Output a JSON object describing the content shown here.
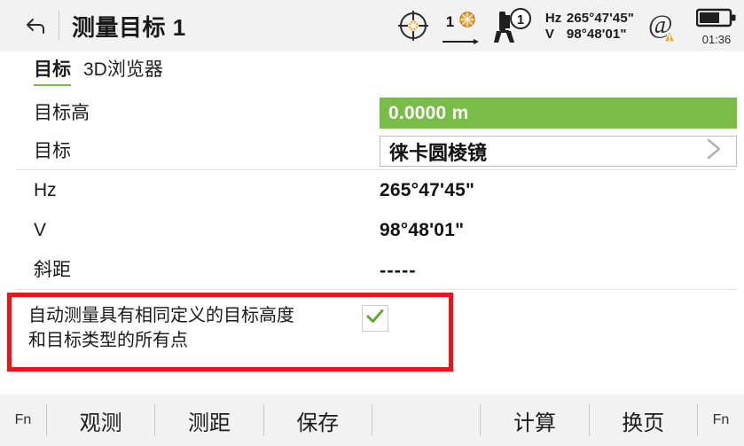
{
  "header": {
    "back_icon": "back-arrow-icon",
    "title": "测量目标 1"
  },
  "status_bar": {
    "target_lock_icon": "crosshair-target-icon",
    "prism_number": "1",
    "prism_icon": "prism-icon",
    "prism_arrow_icon": "arrow-right-icon",
    "instrument_icon": "total-station-icon",
    "instrument_badge": "1",
    "hz_label": "Hz",
    "hz_value": "265°47'45\"",
    "v_label": "V",
    "v_value": "98°48'01\"",
    "at_icon": "at-sign-warning-icon",
    "battery_icon": "battery-icon",
    "battery_level_percent": 62,
    "battery_time": "01:36"
  },
  "tabs": [
    {
      "label": "目标",
      "active": true
    },
    {
      "label": "3D浏览器",
      "active": false
    }
  ],
  "form": {
    "rows": [
      {
        "label": "目标高",
        "value": "0.0000 m",
        "style": "green-field"
      },
      {
        "label": "目标",
        "value": "徕卡圆棱镜",
        "style": "boxed-field",
        "chevron": "chevron-right-icon"
      },
      {
        "label": "Hz",
        "value": "265°47'45\"",
        "style": "plain"
      },
      {
        "label": "V",
        "value": "98°48'01\"",
        "style": "plain"
      },
      {
        "label": "斜距",
        "value": "-----",
        "style": "plain-dashes"
      }
    ]
  },
  "checkbox_option": {
    "text_line1": "自动测量具有相同定义的目标高度",
    "text_line2": "和目标类型的所有点",
    "checked": true,
    "check_icon": "check-mark-icon",
    "highlight_color": "#e51717"
  },
  "toolbar": {
    "left_fn": "Fn",
    "buttons": [
      {
        "label": "观测"
      },
      {
        "label": "测距"
      },
      {
        "label": "保存"
      },
      {
        "label": ""
      },
      {
        "label": "计算"
      },
      {
        "label": "换页"
      }
    ],
    "right_fn": "Fn"
  },
  "colors": {
    "accent_green": "#78bd45",
    "tab_underline": "#7ab648",
    "highlight_red": "#e51717",
    "chrome_gray": "#f2f2f2"
  }
}
